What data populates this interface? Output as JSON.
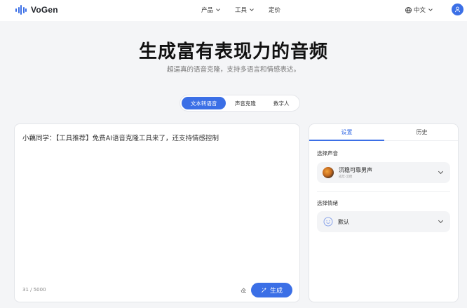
{
  "header": {
    "logo_text": "VoGen",
    "nav": [
      "产品",
      "工具",
      "定价"
    ],
    "language": "中文"
  },
  "hero": {
    "title": "生成富有表现力的音频",
    "subtitle": "超逼真的语音克隆，支持多语言和情感表达。"
  },
  "mode_tabs": {
    "items": [
      "文本转语音",
      "声音克隆",
      "数字人"
    ],
    "active": 0
  },
  "editor": {
    "text": "小藕同学：【工具推荐】免费AI语音克隆工具来了，还支持情感控制",
    "counter": "31 / 5000",
    "generate_label": "生成"
  },
  "panel": {
    "tabs": [
      "设置",
      "历史"
    ],
    "active_tab": 0,
    "voice_label": "选择声音",
    "voice_name": "沉稳可靠男声",
    "voice_tag": "成年·沉稳",
    "emotion_label": "选择情绪",
    "emotion_value": "默认"
  },
  "colors": {
    "accent": "#3b6fe6",
    "background": "#f4f5f7"
  },
  "icons": [
    "logo-wave-icon",
    "chevron-down-icon",
    "globe-icon",
    "user-icon",
    "eraser-icon",
    "sparkle-icon",
    "smile-icon"
  ]
}
